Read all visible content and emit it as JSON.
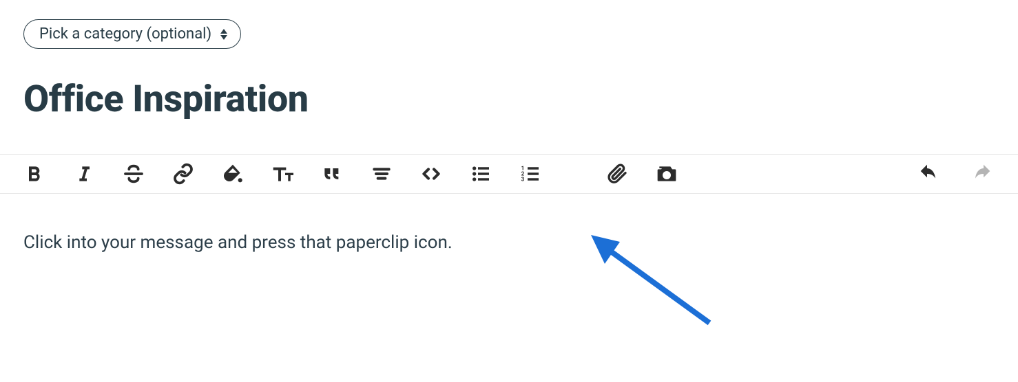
{
  "category_selector": {
    "label": "Pick a category (optional)"
  },
  "post": {
    "title": "Office Inspiration"
  },
  "toolbar": {
    "bold": "B",
    "italic": "I"
  },
  "editor": {
    "content": "Click into your message and press that paperclip icon."
  },
  "annotation": {
    "color": "#1c6fd6"
  }
}
